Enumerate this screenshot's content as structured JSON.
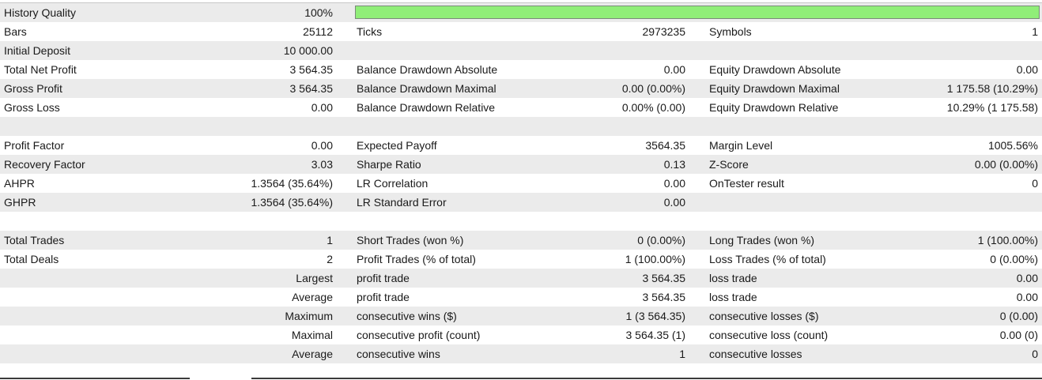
{
  "rows": {
    "history_quality": {
      "label": "History Quality",
      "value": "100%",
      "quality_fraction": 1.0
    },
    "bars": {
      "label": "Bars",
      "value": "25112",
      "label2": "Ticks",
      "value2": "2973235",
      "label3": "Symbols",
      "value3": "1"
    },
    "initial_deposit": {
      "label": "Initial Deposit",
      "value": "10 000.00"
    },
    "total_net_profit": {
      "label": "Total Net Profit",
      "value": "3 564.35",
      "label2": "Balance Drawdown Absolute",
      "value2": "0.00",
      "label3": "Equity Drawdown Absolute",
      "value3": "0.00"
    },
    "gross_profit": {
      "label": "Gross Profit",
      "value": "3 564.35",
      "label2": "Balance Drawdown Maximal",
      "value2": "0.00 (0.00%)",
      "label3": "Equity Drawdown Maximal",
      "value3": "1 175.58 (10.29%)"
    },
    "gross_loss": {
      "label": "Gross Loss",
      "value": "0.00",
      "label2": "Balance Drawdown Relative",
      "value2": "0.00% (0.00)",
      "label3": "Equity Drawdown Relative",
      "value3": "10.29% (1 175.58)"
    },
    "profit_factor": {
      "label": "Profit Factor",
      "value": "0.00",
      "label2": "Expected Payoff",
      "value2": "3564.35",
      "label3": "Margin Level",
      "value3": "1005.56%"
    },
    "recovery_factor": {
      "label": "Recovery Factor",
      "value": "3.03",
      "label2": "Sharpe Ratio",
      "value2": "0.13",
      "label3": "Z-Score",
      "value3": "0.00 (0.00%)"
    },
    "ahpr": {
      "label": "AHPR",
      "value": "1.3564 (35.64%)",
      "label2": "LR Correlation",
      "value2": "0.00",
      "label3": "OnTester result",
      "value3": "0"
    },
    "ghpr": {
      "label": "GHPR",
      "value": "1.3564 (35.64%)",
      "label2": "LR Standard Error",
      "value2": "0.00"
    },
    "total_trades": {
      "label": "Total Trades",
      "value": "1",
      "label2": "Short Trades (won %)",
      "value2": "0 (0.00%)",
      "label3": "Long Trades (won %)",
      "value3": "1 (100.00%)"
    },
    "total_deals": {
      "label": "Total Deals",
      "value": "2",
      "label2": "Profit Trades (% of total)",
      "value2": "1 (100.00%)",
      "label3": "Loss Trades (% of total)",
      "value3": "0 (0.00%)"
    },
    "largest": {
      "qualifier": "Largest",
      "label2": "profit trade",
      "value2": "3 564.35",
      "label3": "loss trade",
      "value3": "0.00"
    },
    "average": {
      "qualifier": "Average",
      "label2": "profit trade",
      "value2": "3 564.35",
      "label3": "loss trade",
      "value3": "0.00"
    },
    "maximum": {
      "qualifier": "Maximum",
      "label2": "consecutive wins ($)",
      "value2": "1 (3 564.35)",
      "label3": "consecutive losses ($)",
      "value3": "0 (0.00)"
    },
    "maximal": {
      "qualifier": "Maximal",
      "label2": "consecutive profit (count)",
      "value2": "3 564.35 (1)",
      "label3": "consecutive loss (count)",
      "value3": "0.00 (0)"
    },
    "average_cons": {
      "qualifier": "Average",
      "label2": "consecutive wins",
      "value2": "1",
      "label3": "consecutive losses",
      "value3": "0"
    }
  },
  "colors": {
    "quality_bar_fill": "#90ee78",
    "row_shade": "#ebebeb"
  }
}
